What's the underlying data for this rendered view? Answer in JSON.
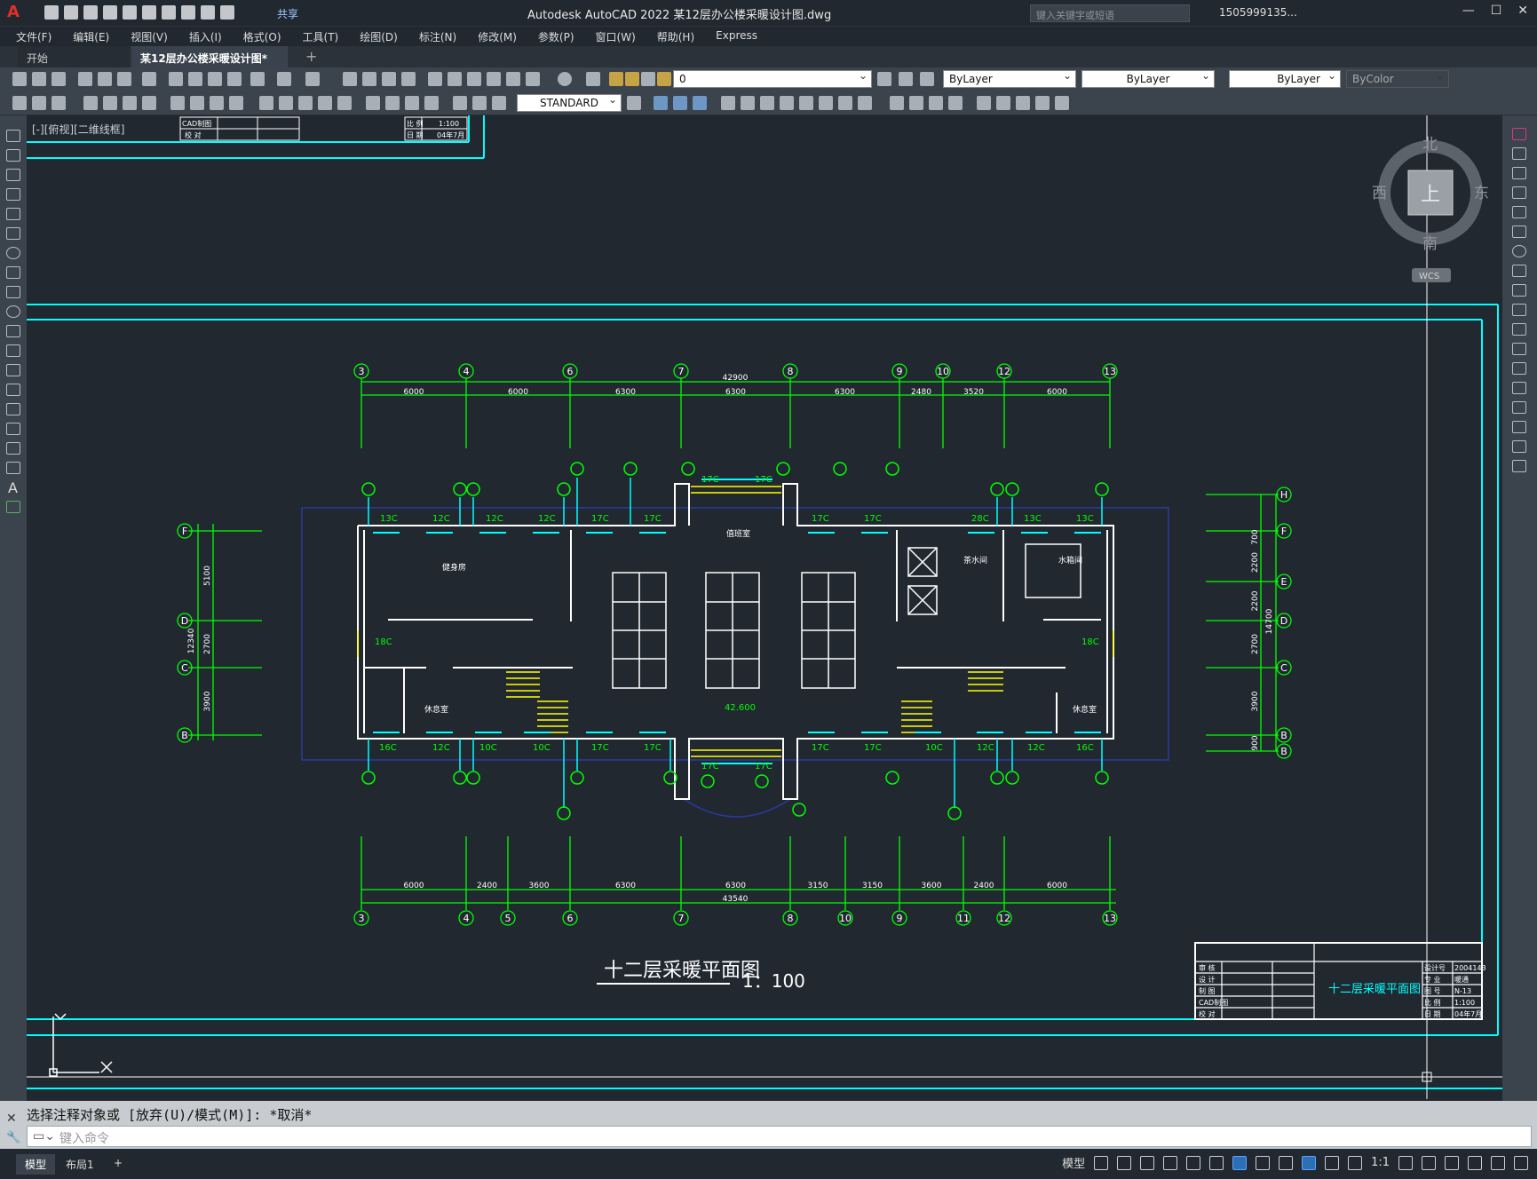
{
  "app": {
    "title": "Autodesk AutoCAD 2022    某12层办公楼采暖设计图.dwg",
    "share": "共享",
    "search_placeholder": "键入关键字或短语",
    "user": "1505999135..."
  },
  "menu": [
    "文件(F)",
    "编辑(E)",
    "视图(V)",
    "插入(I)",
    "格式(O)",
    "工具(T)",
    "绘图(D)",
    "标注(N)",
    "修改(M)",
    "参数(P)",
    "窗口(W)",
    "帮助(H)",
    "Express"
  ],
  "tabs": {
    "start": "开始",
    "doc": "某12层办公楼采暖设计图*",
    "doc_close": "×",
    "plus": "+"
  },
  "toolbar": {
    "layer": "0",
    "color": "ByLayer",
    "linetype": "ByLayer",
    "lineweight": "ByLayer",
    "plotstyle": "ByColor",
    "textstyle": "STANDARD"
  },
  "viewport_label": "[-][俯视][二维线框]",
  "viewcube": {
    "north": "北",
    "south": "南",
    "east": "东",
    "west": "西",
    "top": "上",
    "wcs": "WCS"
  },
  "drawing": {
    "title": "十二层采暖平面图",
    "scale": "1：100",
    "top_axes": [
      "3",
      "4",
      "6",
      "7",
      "8",
      "9",
      "10",
      "12",
      "13"
    ],
    "top_dims": [
      "6000",
      "6000",
      "6300",
      "6300",
      "6300",
      "2480",
      "3520",
      "6000"
    ],
    "top_total": "42900",
    "bottom_axes": [
      "3",
      "4",
      "5",
      "6",
      "7",
      "8",
      "10",
      "9",
      "11",
      "12",
      "13"
    ],
    "bottom_dims": [
      "6000",
      "2400",
      "3600",
      "6300",
      "6300",
      "3150",
      "3150",
      "3600",
      "2400",
      "6000"
    ],
    "bottom_total": "43540",
    "left_axes": [
      "F",
      "D",
      "C",
      "B"
    ],
    "left_dims": [
      "5100",
      "2700",
      "3900"
    ],
    "left_total": "12340",
    "right_axes": [
      "H",
      "F",
      "E",
      "D",
      "C",
      "B",
      "B"
    ],
    "right_dims": [
      "700",
      "2200",
      "2200",
      "2700",
      "3900",
      "900"
    ],
    "right_total": "14700",
    "room_labels": [
      "健身房",
      "值班室",
      "茶水间",
      "休息室",
      "休息室",
      "水箱间",
      "42.600"
    ],
    "radiators_top": [
      "13C",
      "12C",
      "12C",
      "12C",
      "17C",
      "17C",
      "17C",
      "17C",
      "17C",
      "17C",
      "28C",
      "13C",
      "13C"
    ],
    "radiators_bottom": [
      "16C",
      "12C",
      "10C",
      "10C",
      "17C",
      "17C",
      "17C",
      "17C",
      "17C",
      "17C",
      "10C",
      "12C",
      "12C",
      "16C"
    ],
    "radiators_side": [
      "18C",
      "18C"
    ],
    "titleblock_name": "十二层采暖平面图",
    "titleblock_right": [
      "2004143",
      "暖通",
      "N-13",
      "1:100",
      "04年7月"
    ],
    "titleblock_left": [
      "审 核",
      "设 计",
      "制 图",
      "CAD制图",
      "校 对"
    ],
    "titleblock_right_labels": [
      "设计号",
      "专 业",
      "图 号",
      "比 例",
      "日 期"
    ],
    "small_tb": [
      "CAD制图",
      "校 对",
      "比 例",
      "1:100",
      "日 期",
      "04年7月"
    ]
  },
  "command": {
    "history": "选择注释对象或 [放弃(U)/模式(M)]: *取消*",
    "placeholder": "键入命令"
  },
  "status": {
    "model": "模型",
    "layout": "布局1",
    "plus": "+",
    "scale": "1:1"
  },
  "colors": {
    "bg": "#212830",
    "cyan": "#00ffff",
    "green": "#00ff00",
    "yellow": "#ffff00",
    "white": "#ffffff"
  }
}
